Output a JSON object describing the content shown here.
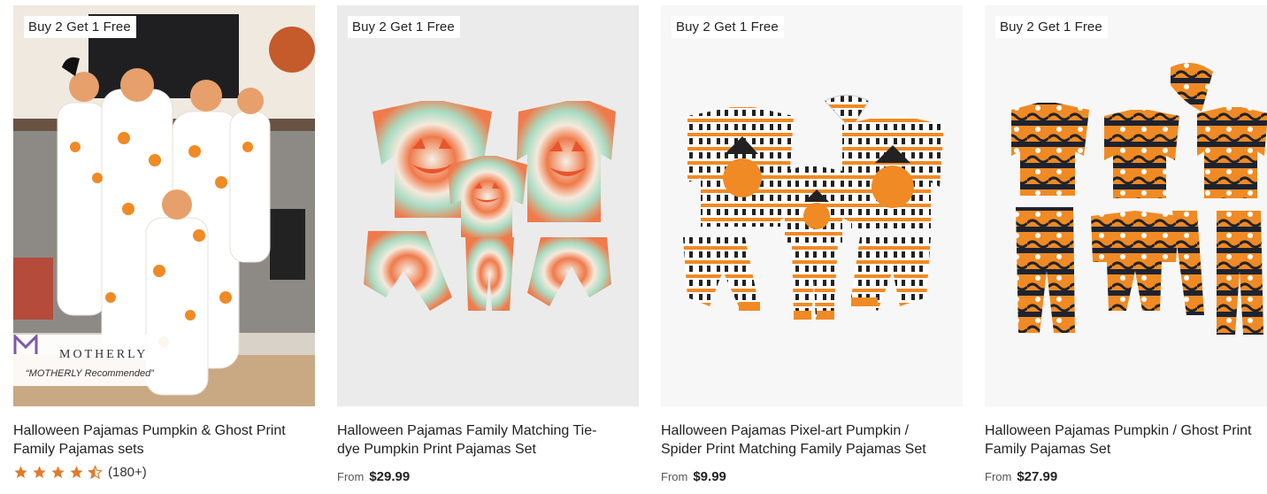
{
  "products": [
    {
      "badge": "Buy 2 Get 1 Free",
      "title_line1": "Halloween Pajamas Pumpkin & Ghost Print",
      "title_line2": "Family Pajamas sets",
      "rating_stars": 4.5,
      "reviews": "(180+)",
      "endorsement_brand": "MOTHERLY",
      "endorsement_quote": "“MOTHERLY Recommended”"
    },
    {
      "badge": "Buy 2 Get 1 Free",
      "title_line1": "Halloween Pajamas Family Matching Tie-",
      "title_line2": "dye Pumpkin Print Pajamas Set",
      "from_label": "From",
      "price": "$29.99"
    },
    {
      "badge": "Buy 2 Get 1 Free",
      "title_line1": "Halloween Pajamas Pixel-art Pumpkin /",
      "title_line2": "Spider Print Matching Family Pajamas Set",
      "from_label": "From",
      "price": "$9.99"
    },
    {
      "badge": "Buy 2 Get 1 Free",
      "title_line1": "Halloween Pajamas Pumpkin / Ghost Print",
      "title_line2": "Family Pajamas Set",
      "from_label": "From",
      "price": "$27.99"
    }
  ],
  "colors": {
    "star": "#e07a2c",
    "pumpkin_orange": "#f08a24",
    "tiedye_mint": "#a9dcc3",
    "tiedye_coral": "#f07a4a",
    "motherly_purple": "#7b5aa6"
  }
}
